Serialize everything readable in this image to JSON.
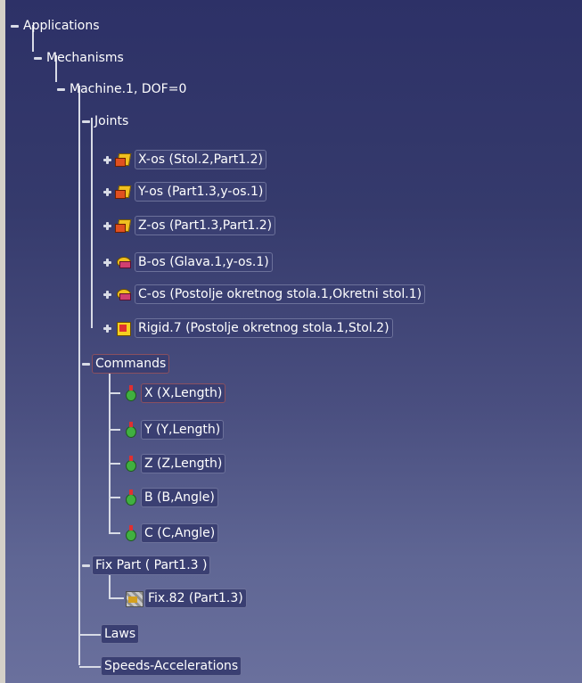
{
  "tree": {
    "applications": "Applications",
    "mechanisms": "Mechanisms",
    "machine": "Machine.1, DOF=0",
    "joints": {
      "label": "Joints",
      "items": [
        {
          "label": "X-os (Stol.2,Part1.2)",
          "icon": "prismatic-joint-icon"
        },
        {
          "label": "Y-os (Part1.3,y-os.1)",
          "icon": "prismatic-joint-icon"
        },
        {
          "label": "Z-os (Part1.3,Part1.2)",
          "icon": "prismatic-joint-icon"
        },
        {
          "label": "B-os (Glava.1,y-os.1)",
          "icon": "revolute-joint-icon"
        },
        {
          "label": "C-os (Postolje okretnog stola.1,Okretni stol.1)",
          "icon": "revolute-joint-icon"
        },
        {
          "label": "Rigid.7 (Postolje okretnog stola.1,Stol.2)",
          "icon": "rigid-joint-icon"
        }
      ]
    },
    "commands": {
      "label": "Commands",
      "items": [
        {
          "label": "X (X,Length)",
          "icon": "command-icon"
        },
        {
          "label": "Y (Y,Length)",
          "icon": "command-icon"
        },
        {
          "label": "Z (Z,Length)",
          "icon": "command-icon"
        },
        {
          "label": "B (B,Angle)",
          "icon": "command-icon"
        },
        {
          "label": "C (C,Angle)",
          "icon": "command-icon"
        }
      ]
    },
    "fix_part": {
      "label": "Fix Part ( Part1.3 )",
      "items": [
        {
          "label": "Fix.82 (Part1.3)",
          "icon": "fix-icon"
        }
      ]
    },
    "laws": "Laws",
    "speeds": "Speeds-Accelerations"
  }
}
